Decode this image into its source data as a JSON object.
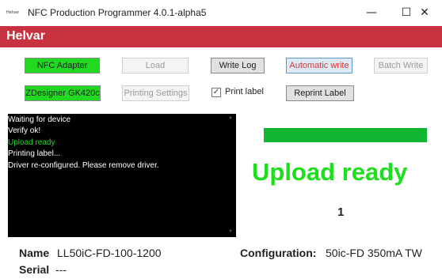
{
  "window": {
    "icon_text": "Helvar",
    "title": "NFC Production Programmer 4.0.1-alpha5",
    "controls": {
      "minimize": "—",
      "maximize": "☐",
      "close": "✕"
    }
  },
  "brand": {
    "name": "Helvar",
    "color": "#c8313f"
  },
  "toolbar": {
    "nfc_adapter": "NFC Adapter",
    "load": "Load",
    "write_log": "Write Log",
    "automatic_write": "Automatic write",
    "batch_write": "Batch Write",
    "printer": "ZDesigner GK420c",
    "printing_settings": "Printing Settings",
    "print_label": {
      "label": "Print label",
      "checked": true,
      "check_glyph": "✓"
    },
    "reprint_label": "Reprint Label"
  },
  "log": [
    {
      "text": "Waiting for device",
      "color": "#ffffff"
    },
    {
      "text": "Verify ok!",
      "color": "#ffffff"
    },
    {
      "text": "Upload ready",
      "color": "#1be01b"
    },
    {
      "text": "Printing label...",
      "color": "#ffffff"
    },
    {
      "text": "Driver re-configured. Please remove driver.",
      "color": "#ffffff"
    }
  ],
  "log_scroll": {
    "up": "▲",
    "down": "▼"
  },
  "status": {
    "progress": 1.0,
    "progress_color": "#10b534",
    "text": "Upload ready",
    "text_color": "#1be01b",
    "count": "1"
  },
  "device": {
    "name_label": "Name",
    "name_value": "LL50iC-FD-100-1200",
    "serial_label": "Serial",
    "serial_value": "---",
    "configuration_label": "Configuration:",
    "configuration_value": "50ic-FD 350mA TW"
  }
}
